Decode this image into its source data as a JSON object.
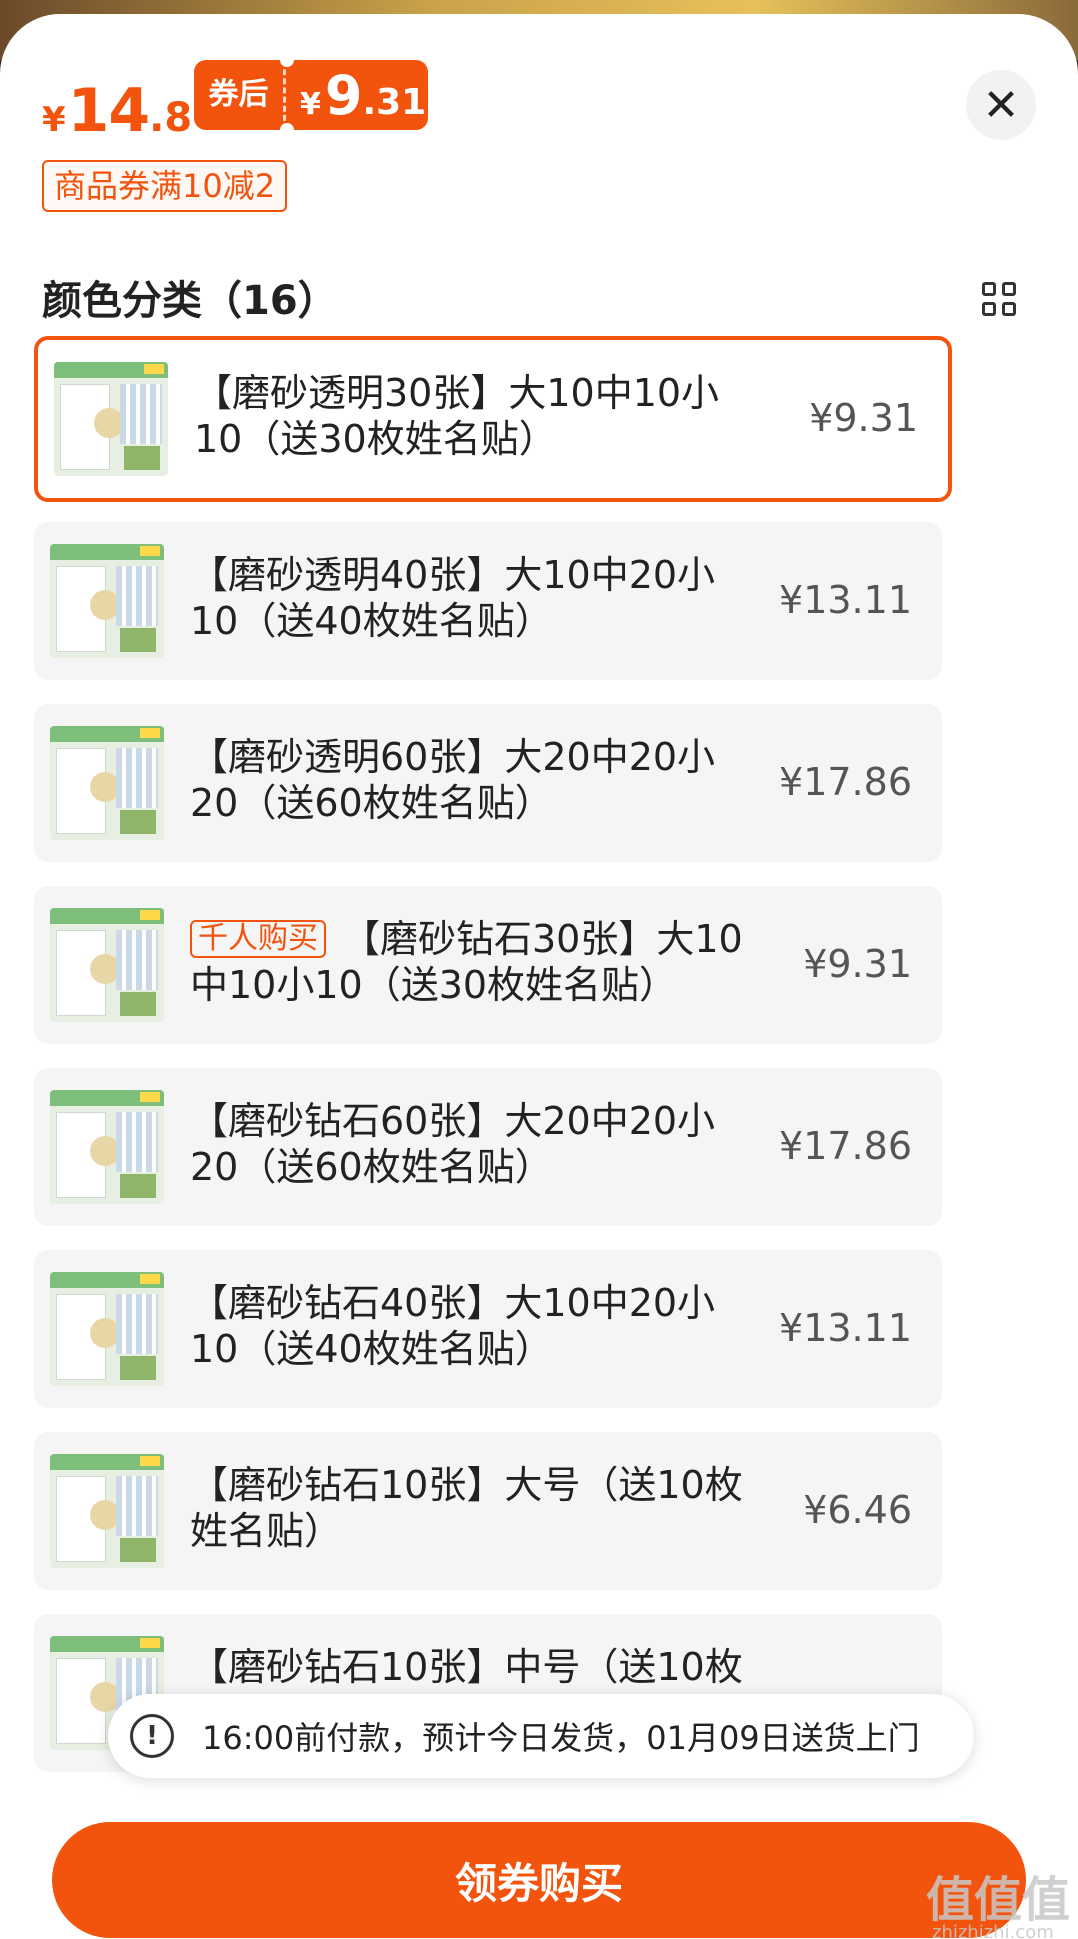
{
  "header": {
    "price_yen": "¥",
    "price_int": "14",
    "price_dec": ".8",
    "coupon_label": "券后",
    "after_yen": "¥",
    "after_int": "9",
    "after_dec": ".31",
    "promo": "商品券满10减2",
    "close_icon": "close-icon"
  },
  "section": {
    "title": "颜色分类（16）",
    "view_icon": "grid-view-icon"
  },
  "skus": [
    {
      "tag": "",
      "text": "【磨砂透明30张】大10中10小10（送30枚姓名贴）",
      "price": "¥9.31",
      "selected": true
    },
    {
      "tag": "",
      "text": "【磨砂透明40张】大10中20小10（送40枚姓名贴）",
      "price": "¥13.11",
      "selected": false
    },
    {
      "tag": "",
      "text": "【磨砂透明60张】大20中20小20（送60枚姓名贴）",
      "price": "¥17.86",
      "selected": false
    },
    {
      "tag": "千人购买",
      "text": "【磨砂钻石30张】大10中10小10（送30枚姓名贴）",
      "price": "¥9.31",
      "selected": false
    },
    {
      "tag": "",
      "text": "【磨砂钻石60张】大20中20小20（送60枚姓名贴）",
      "price": "¥17.86",
      "selected": false
    },
    {
      "tag": "",
      "text": "【磨砂钻石40张】大10中20小10（送40枚姓名贴）",
      "price": "¥13.11",
      "selected": false
    },
    {
      "tag": "",
      "text": "【磨砂钻石10张】大号（送10枚姓名贴）",
      "price": "¥6.46",
      "selected": false
    },
    {
      "tag": "",
      "text": "【磨砂钻石10张】中号（送10枚",
      "price": "",
      "selected": false
    }
  ],
  "delivery": {
    "icon": "alert-circle-icon",
    "text": "16:00前付款，预计今日发货，01月09日送货上门"
  },
  "action": {
    "buy_label": "领券购买"
  },
  "watermark": {
    "logo": "值值值",
    "url": "zhizhizhi.com"
  },
  "colors": {
    "accent": "#f2540d"
  }
}
